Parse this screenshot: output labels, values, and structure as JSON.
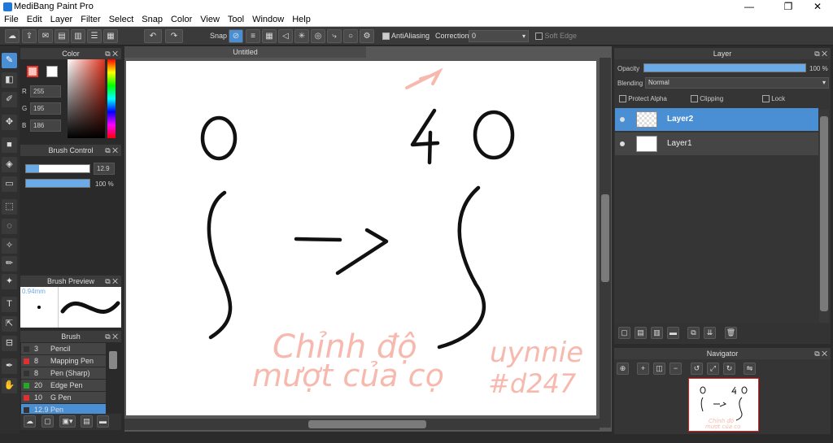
{
  "window": {
    "title": "MediBang Paint Pro",
    "minimize": "—",
    "maximize": "❐",
    "close": "✕"
  },
  "menu": [
    "File",
    "Edit",
    "Layer",
    "Filter",
    "Select",
    "Snap",
    "Color",
    "View",
    "Tool",
    "Window",
    "Help"
  ],
  "toolbar": {
    "snap_label": "Snap",
    "antialias_label": "AntiAliasing",
    "antialias_checked": true,
    "correction_label": "Correction",
    "correction_value": "0",
    "softedge_label": "Soft Edge",
    "softedge_checked": false
  },
  "color_panel": {
    "title": "Color",
    "r_label": "R",
    "r": "255",
    "g_label": "G",
    "g": "195",
    "b_label": "B",
    "b": "186",
    "fg_color": "#ffc3ba",
    "bg_color": "#ffffff"
  },
  "brush_control": {
    "title": "Brush Control",
    "size": "12.9",
    "size_fraction": 0.2,
    "opacity": "100 %",
    "opacity_fraction": 1.0
  },
  "brush_preview": {
    "title": "Brush Preview",
    "size_label": "0.94mm"
  },
  "brush_list": {
    "title": "Brush",
    "items": [
      {
        "size": "3",
        "name": "Pencil",
        "color": "#333333"
      },
      {
        "size": "8",
        "name": "Mapping Pen",
        "color": "#e03030"
      },
      {
        "size": "8",
        "name": "Pen (Sharp)",
        "color": "#333333"
      },
      {
        "size": "20",
        "name": "Edge Pen",
        "color": "#22aa22"
      },
      {
        "size": "10",
        "name": "G Pen",
        "color": "#e03030"
      },
      {
        "size": "12.9",
        "name": "Pen",
        "color": "#333333",
        "selected": true
      }
    ]
  },
  "document": {
    "tab": "Untitled"
  },
  "canvas_text": {
    "line1": "Chỉnh độ",
    "line2": "mượt của cọ",
    "sig1": "uynnie",
    "sig2": "#d247",
    "ink_color": "#f7b9ae"
  },
  "layer_panel": {
    "title": "Layer",
    "opacity_label": "Opacity",
    "opacity_value": "100 %",
    "opacity_fraction": 1.0,
    "blending_label": "Blending",
    "blending_value": "Normal",
    "protect_alpha": "Protect Alpha",
    "clipping": "Clipping",
    "lock": "Lock",
    "layers": [
      {
        "name": "Layer2",
        "selected": true
      },
      {
        "name": "Layer1",
        "selected": false
      }
    ]
  },
  "navigator": {
    "title": "Navigator"
  },
  "icons": [
    "cloud-icon",
    "upload-icon",
    "comment-icon",
    "book-icon",
    "document-icon",
    "grid-icon",
    "undo-icon",
    "redo-icon",
    "snap-off-icon",
    "pen-tool-icon",
    "eraser-icon",
    "move-icon",
    "fill-icon",
    "text-icon",
    "hand-icon"
  ]
}
